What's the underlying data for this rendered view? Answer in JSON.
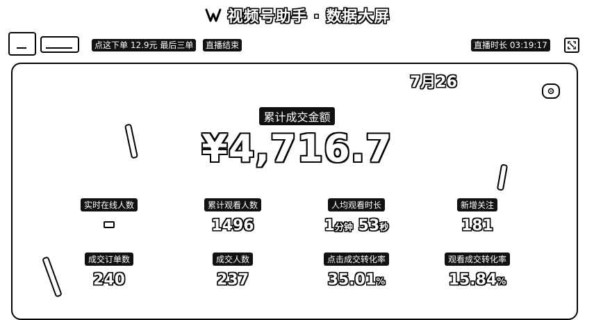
{
  "header": {
    "title": "视频号助手 · 数据大屏"
  },
  "topbar": {
    "order_notice": "点这下单 12.9元 最后三单",
    "live_status": "直播结束",
    "duration_text": "直播时长 03:19:17"
  },
  "main": {
    "date": "7月26",
    "gmv_label": "累计成交金额",
    "gmv_value": "¥4,716.7",
    "metrics": [
      {
        "label": "实时在线人数",
        "value": "–"
      },
      {
        "label": "累计观看人数",
        "value": "1496"
      },
      {
        "label": "人均观看时长",
        "value_min": "1",
        "unit_min": "分钟",
        "value_sec": "53",
        "unit_sec": "秒"
      },
      {
        "label": "新增关注",
        "value": "181"
      },
      {
        "label": "成交订单数",
        "value": "240"
      },
      {
        "label": "成交人数",
        "value": "237"
      },
      {
        "label": "点击成交转化率",
        "value": "35.01",
        "unit": "%"
      },
      {
        "label": "观看成交转化率",
        "value": "15.84",
        "unit": "%"
      }
    ]
  },
  "icons": {
    "logo": "video-account-logo-icon",
    "fullscreen": "fullscreen-icon",
    "settings": "settings-icon"
  }
}
